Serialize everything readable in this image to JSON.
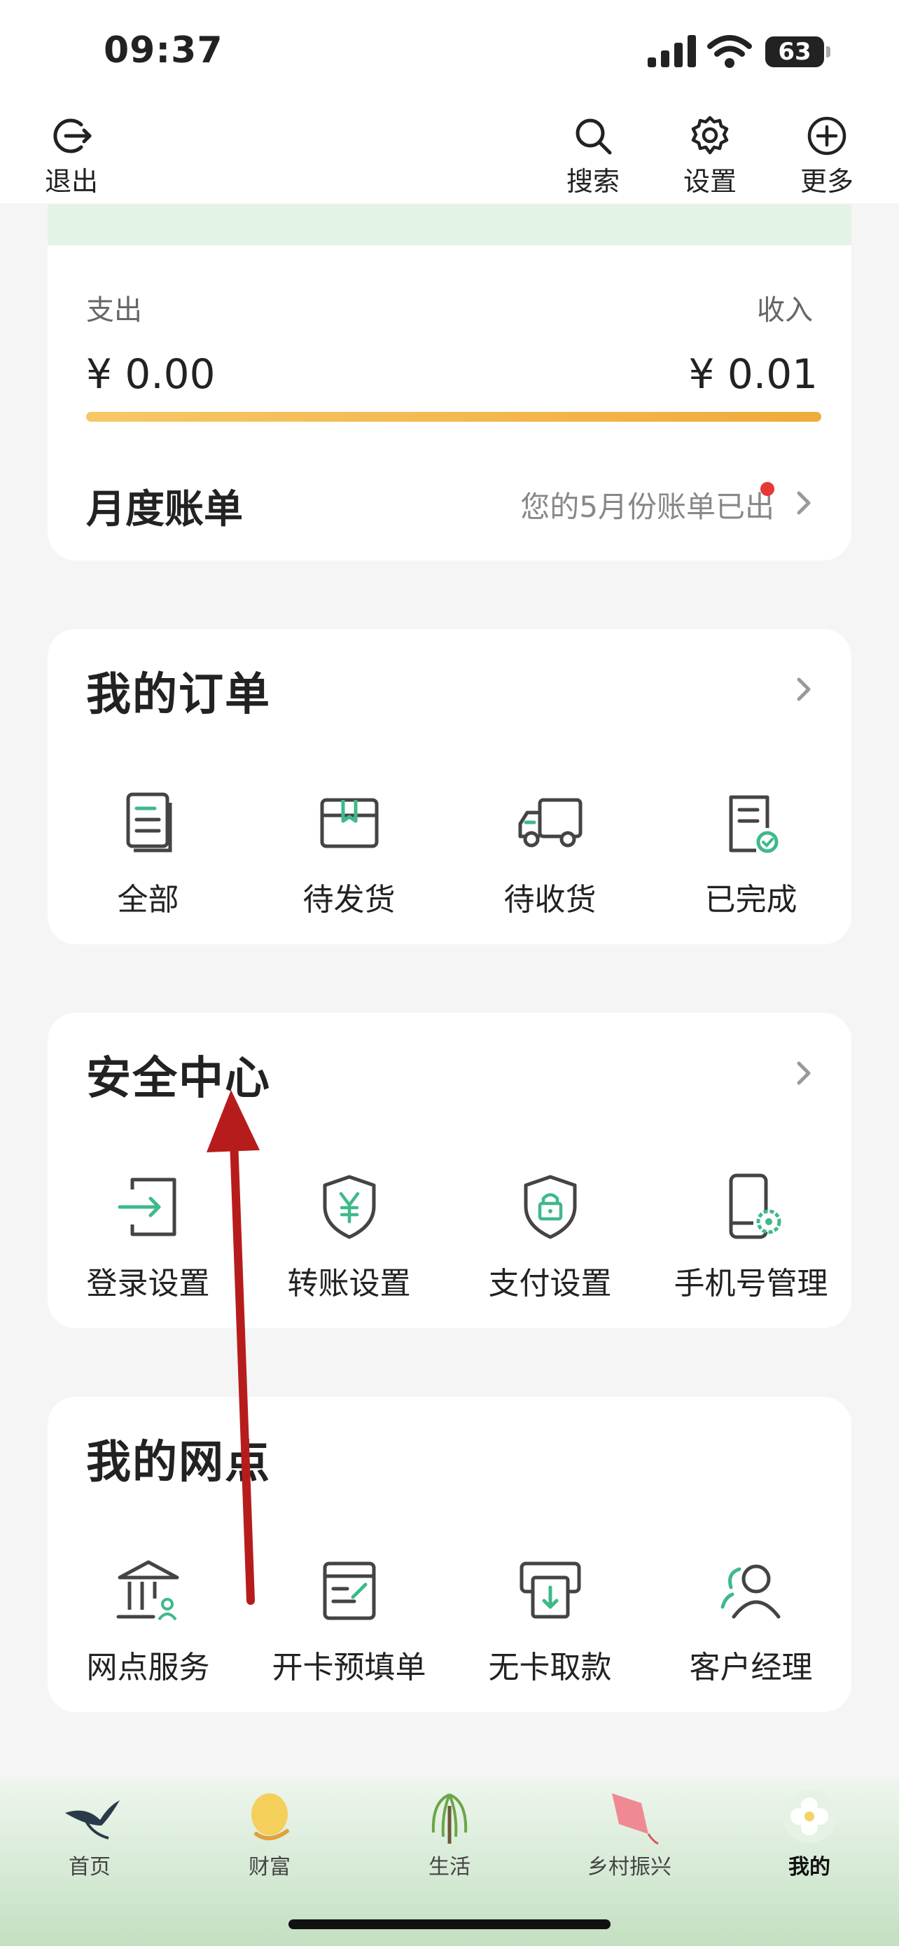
{
  "status_bar": {
    "time": "09:37",
    "battery": "63"
  },
  "top_nav": {
    "exit": "退出",
    "search": "搜索",
    "settings": "设置",
    "more": "更多"
  },
  "summary": {
    "expense_label": "支出",
    "income_label": "收入",
    "expense_amount": "¥ 0.00",
    "income_amount": "¥ 0.01",
    "ratio": 1.0,
    "monthly_bill_title": "月度账单",
    "monthly_bill_note": "您的5月份账单已出"
  },
  "orders": {
    "title": "我的订单",
    "items": [
      {
        "label": "全部",
        "icon": "document-icon"
      },
      {
        "label": "待发货",
        "icon": "package-icon"
      },
      {
        "label": "待收货",
        "icon": "truck-icon"
      },
      {
        "label": "已完成",
        "icon": "checked-document-icon"
      }
    ]
  },
  "security": {
    "title": "安全中心",
    "items": [
      {
        "label": "登录设置",
        "icon": "login-icon"
      },
      {
        "label": "转账设置",
        "icon": "yuan-shield-icon"
      },
      {
        "label": "支付设置",
        "icon": "lock-shield-icon"
      },
      {
        "label": "手机号管理",
        "icon": "phone-gear-icon"
      }
    ]
  },
  "branch": {
    "title": "我的网点",
    "items": [
      {
        "label": "网点服务",
        "icon": "bank-icon"
      },
      {
        "label": "开卡预填单",
        "icon": "form-icon"
      },
      {
        "label": "无卡取款",
        "icon": "atm-icon"
      },
      {
        "label": "客户经理",
        "icon": "manager-icon"
      }
    ]
  },
  "tab_bar": {
    "items": [
      {
        "label": "首页",
        "icon": "swallow-icon"
      },
      {
        "label": "财富",
        "icon": "wealth-icon"
      },
      {
        "label": "生活",
        "icon": "willow-icon"
      },
      {
        "label": "乡村振兴",
        "icon": "kite-icon"
      },
      {
        "label": "我的",
        "icon": "flower-icon"
      }
    ],
    "active": "我的"
  },
  "colors": {
    "accent_green": "#3fb98a",
    "progress_orange": "#f0ab3a",
    "annotation_red": "#b71c1c"
  }
}
